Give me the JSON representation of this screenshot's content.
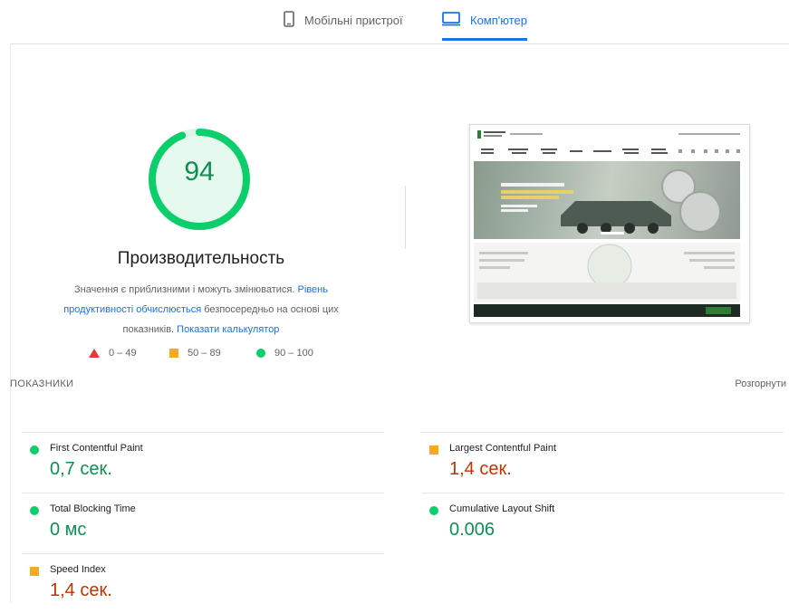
{
  "tabs": {
    "mobile_label": "Мобільні пристрої",
    "desktop_label": "Комп'ютер",
    "active": "desktop"
  },
  "gauge": {
    "score": "94",
    "fraction": 0.94,
    "color": "#0cce6b"
  },
  "performance": {
    "title": "Производительность",
    "desc_prefix": "Значення є приблизними і можуть змінюватися. ",
    "link1": "Рівень продуктивності обчислюється",
    "desc_middle": " безпосередньо на основі цих показників. ",
    "link2": "Показати калькулятор"
  },
  "legend": [
    {
      "range": "0 – 49",
      "shape": "triangle",
      "color": "#e53935"
    },
    {
      "range": "50 – 89",
      "shape": "square",
      "color": "#f9a825"
    },
    {
      "range": "90 – 100",
      "shape": "circle",
      "color": "#0cce6b"
    }
  ],
  "metrics_section": {
    "label": "ПОКАЗНИКИ",
    "expand": "Розгорнути"
  },
  "metrics": [
    {
      "title": "First Contentful Paint",
      "value": "0,7 сек.",
      "status": "good"
    },
    {
      "title": "Largest Contentful Paint",
      "value": "1,4 сек.",
      "status": "average"
    },
    {
      "title": "Total Blocking Time",
      "value": "0 мс",
      "status": "good"
    },
    {
      "title": "Cumulative Layout Shift",
      "value": "0.006",
      "status": "good"
    },
    {
      "title": "Speed Index",
      "value": "1,4 сек.",
      "status": "average"
    }
  ],
  "screenshot": {
    "icons": [
      "bank-logo-icon",
      "hero-banner-icon",
      "coin-icon",
      "cookie-banner-icon"
    ],
    "colors": {
      "hero": "#a9b7ad",
      "cookie_bar": "#1e2a24",
      "accept": "#2e7d32"
    }
  },
  "colors": {
    "accent": "#1a73e8",
    "good": "#0d904f",
    "average": "#c33300"
  }
}
